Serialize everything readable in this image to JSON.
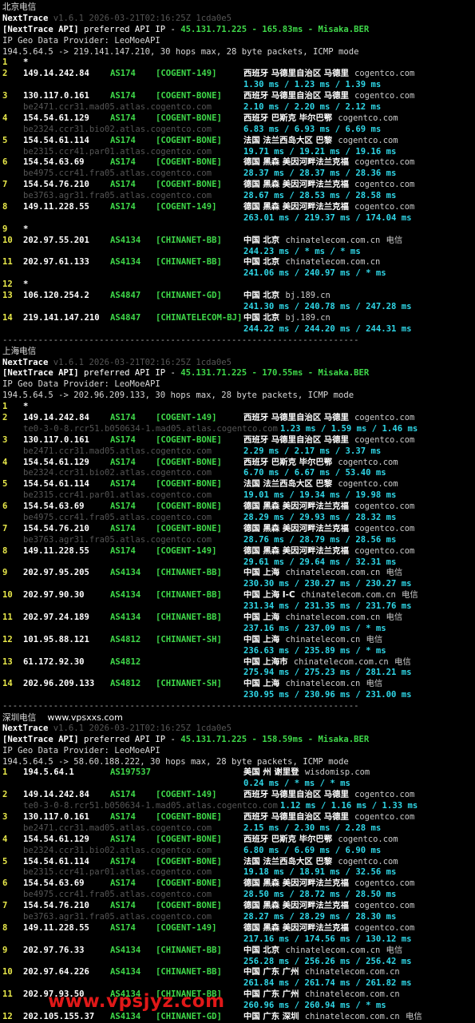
{
  "sections": [
    {
      "title": "北京电信",
      "watermark": "",
      "header": {
        "app": "NextTrace",
        "version_line": "v1.6.1 2026-03-21T02:16:25Z 1cda0e5",
        "api_prefix": "[NextTrace API]",
        "api_text": " preferred API IP - ",
        "api_ip": "45.131.71.225",
        "api_dash": " - ",
        "api_ms": "165.83ms",
        "api_node": "Misaka.BER",
        "geo_provider": "IP Geo Data Provider: LeoMoeAPI",
        "trace_cmd": "194.5.64.5 -> 219.141.147.210, 30 hops max, 28 byte packets, ICMP mode"
      },
      "hops": [
        {
          "n": "1",
          "ip": "*",
          "as": "",
          "tag": "",
          "geo": "",
          "host": "",
          "isp": "",
          "rdns": "",
          "rtt": ""
        },
        {
          "n": "2",
          "ip": "149.14.242.84",
          "as": "AS174",
          "tag": "[COGENT-149]",
          "geo": "西班牙 马德里自治区 马德里",
          "host": "cogentco.com",
          "isp": "",
          "rdns": "",
          "rtt": "1.30 ms / 1.23 ms / 1.39 ms"
        },
        {
          "n": "3",
          "ip": "130.117.0.161",
          "as": "AS174",
          "tag": "[COGENT-BONE]",
          "geo": "西班牙 马德里自治区 马德里",
          "host": "cogentco.com",
          "isp": "",
          "rdns": "be2471.ccr31.mad05.atlas.cogentco.com",
          "rtt": "2.10 ms / 2.20 ms / 2.12 ms"
        },
        {
          "n": "4",
          "ip": "154.54.61.129",
          "as": "AS174",
          "tag": "[COGENT-BONE]",
          "geo": "西班牙 巴斯克 毕尔巴鄂",
          "host": "cogentco.com",
          "isp": "",
          "rdns": "be2324.ccr31.bio02.atlas.cogentco.com",
          "rtt": "6.83 ms / 6.93 ms / 6.69 ms"
        },
        {
          "n": "5",
          "ip": "154.54.61.114",
          "as": "AS174",
          "tag": "[COGENT-BONE]",
          "geo": "法国 法兰西岛大区 巴黎",
          "host": "cogentco.com",
          "isp": "",
          "rdns": "be2315.ccr41.par01.atlas.cogentco.com",
          "rtt": "19.71 ms / 19.21 ms / 19.16 ms"
        },
        {
          "n": "6",
          "ip": "154.54.63.69",
          "as": "AS174",
          "tag": "[COGENT-BONE]",
          "geo": "德国 黑森 美因河畔法兰克福",
          "host": "cogentco.com",
          "isp": "",
          "rdns": "be4975.ccr41.fra05.atlas.cogentco.com",
          "rtt": "28.37 ms / 28.37 ms / 28.36 ms"
        },
        {
          "n": "7",
          "ip": "154.54.76.210",
          "as": "AS174",
          "tag": "[COGENT-BONE]",
          "geo": "德国 黑森 美因河畔法兰克福",
          "host": "cogentco.com",
          "isp": "",
          "rdns": "be3763.agr31.fra05.atlas.cogentco.com",
          "rtt": "28.67 ms / 28.53 ms / 28.58 ms"
        },
        {
          "n": "8",
          "ip": "149.11.228.55",
          "as": "AS174",
          "tag": "[COGENT-149]",
          "geo": "德国 黑森 美因河畔法兰克福",
          "host": "cogentco.com",
          "isp": "",
          "rdns": "",
          "rtt": "263.01 ms / 219.37 ms / 174.04 ms"
        },
        {
          "n": "9",
          "ip": "*",
          "as": "",
          "tag": "",
          "geo": "",
          "host": "",
          "isp": "",
          "rdns": "",
          "rtt": ""
        },
        {
          "n": "10",
          "ip": "202.97.55.201",
          "as": "AS4134",
          "tag": "[CHINANET-BB]",
          "geo": "中国 北京",
          "host": "chinatelecom.com.cn",
          "isp": "电信",
          "rdns": "",
          "rtt": "244.23 ms / * ms / * ms"
        },
        {
          "n": "11",
          "ip": "202.97.61.133",
          "as": "AS4134",
          "tag": "[CHINANET-BB]",
          "geo": "中国 北京",
          "host": "chinatelecom.com.cn",
          "isp": "",
          "rdns": "",
          "rtt": "241.06 ms / 240.97 ms / * ms"
        },
        {
          "n": "12",
          "ip": "*",
          "as": "",
          "tag": "",
          "geo": "",
          "host": "",
          "isp": "",
          "rdns": "",
          "rtt": ""
        },
        {
          "n": "13",
          "ip": "106.120.254.2",
          "as": "AS4847",
          "tag": "[CHINANET-GD]",
          "geo": "中国 北京",
          "host": "bj.189.cn",
          "isp": "",
          "rdns": "",
          "rtt": "241.30 ms / 240.78 ms / 247.28 ms"
        },
        {
          "n": "14",
          "ip": "219.141.147.210",
          "as": "AS4847",
          "tag": "[CHINATELECOM-BJ]",
          "geo": "中国 北京",
          "host": "bj.189.cn",
          "isp": "",
          "rdns": "",
          "rtt": "244.22 ms / 244.20 ms / 244.31 ms"
        }
      ],
      "separator": "----------------------------------------------------------------------"
    },
    {
      "title": "上海电信",
      "watermark": "",
      "header": {
        "app": "NextTrace",
        "version_line": "v1.6.1 2026-03-21T02:16:25Z 1cda0e5",
        "api_prefix": "[NextTrace API]",
        "api_text": " preferred API IP - ",
        "api_ip": "45.131.71.225",
        "api_dash": " - ",
        "api_ms": "170.55ms",
        "api_node": "Misaka.BER",
        "geo_provider": "IP Geo Data Provider: LeoMoeAPI",
        "trace_cmd": "194.5.64.5 -> 202.96.209.133, 30 hops max, 28 byte packets, ICMP mode"
      },
      "hops": [
        {
          "n": "1",
          "ip": "*",
          "as": "",
          "tag": "",
          "geo": "",
          "host": "",
          "isp": "",
          "rdns": "",
          "rtt": ""
        },
        {
          "n": "2",
          "ip": "149.14.242.84",
          "as": "AS174",
          "tag": "[COGENT-149]",
          "geo": "西班牙 马德里自治区 马德里",
          "host": "cogentco.com",
          "isp": "",
          "rdns": "te0-3-0-8.rcr51.b050634-1.mad05.atlas.cogentco.com",
          "rtt": "1.23 ms / 1.59 ms / 1.46 ms",
          "rtt_inline": true
        },
        {
          "n": "3",
          "ip": "130.117.0.161",
          "as": "AS174",
          "tag": "[COGENT-BONE]",
          "geo": "西班牙 马德里自治区 马德里",
          "host": "cogentco.com",
          "isp": "",
          "rdns": "be2471.ccr31.mad05.atlas.cogentco.com",
          "rtt": "2.29 ms / 2.17 ms / 3.37 ms"
        },
        {
          "n": "4",
          "ip": "154.54.61.129",
          "as": "AS174",
          "tag": "[COGENT-BONE]",
          "geo": "西班牙 巴斯克 毕尔巴鄂",
          "host": "cogentco.com",
          "isp": "",
          "rdns": "be2324.ccr31.bio02.atlas.cogentco.com",
          "rtt": "6.70 ms / 6.67 ms / 53.40 ms"
        },
        {
          "n": "5",
          "ip": "154.54.61.114",
          "as": "AS174",
          "tag": "[COGENT-BONE]",
          "geo": "法国 法兰西岛大区 巴黎",
          "host": "cogentco.com",
          "isp": "",
          "rdns": "be2315.ccr41.par01.atlas.cogentco.com",
          "rtt": "19.01 ms / 19.34 ms / 19.98 ms"
        },
        {
          "n": "6",
          "ip": "154.54.63.69",
          "as": "AS174",
          "tag": "[COGENT-BONE]",
          "geo": "德国 黑森 美因河畔法兰克福",
          "host": "cogentco.com",
          "isp": "",
          "rdns": "be4975.ccr41.fra05.atlas.cogentco.com",
          "rtt": "28.29 ms / 29.93 ms / 28.32 ms"
        },
        {
          "n": "7",
          "ip": "154.54.76.210",
          "as": "AS174",
          "tag": "[COGENT-BONE]",
          "geo": "德国 黑森 美因河畔法兰克福",
          "host": "cogentco.com",
          "isp": "",
          "rdns": "be3763.agr31.fra05.atlas.cogentco.com",
          "rtt": "28.76 ms / 28.79 ms / 28.56 ms"
        },
        {
          "n": "8",
          "ip": "149.11.228.55",
          "as": "AS174",
          "tag": "[COGENT-149]",
          "geo": "德国 黑森 美因河畔法兰克福",
          "host": "cogentco.com",
          "isp": "",
          "rdns": "",
          "rtt": "29.61 ms / 29.64 ms / 32.31 ms"
        },
        {
          "n": "9",
          "ip": "202.97.95.205",
          "as": "AS4134",
          "tag": "[CHINANET-BB]",
          "geo": "中国 上海",
          "host": "chinatelecom.com.cn",
          "isp": "电信",
          "rdns": "",
          "rtt": "230.30 ms / 230.27 ms / 230.27 ms"
        },
        {
          "n": "10",
          "ip": "202.97.90.30",
          "as": "AS4134",
          "tag": "[CHINANET-BB]",
          "geo": "中国 上海 I-C",
          "host": "chinatelecom.com.cn",
          "isp": "电信",
          "rdns": "",
          "rtt": "231.34 ms / 231.35 ms / 231.76 ms"
        },
        {
          "n": "11",
          "ip": "202.97.24.189",
          "as": "AS4134",
          "tag": "[CHINANET-BB]",
          "geo": "中国 上海",
          "host": "chinatelecom.com.cn",
          "isp": "电信",
          "rdns": "",
          "rtt": "237.16 ms / 237.09 ms / * ms"
        },
        {
          "n": "12",
          "ip": "101.95.88.121",
          "as": "AS4812",
          "tag": "[CHINANET-SH]",
          "geo": "中国 上海",
          "host": "chinatelecom.cn",
          "isp": "电信",
          "rdns": "",
          "rtt": "236.63 ms / 235.89 ms / * ms"
        },
        {
          "n": "13",
          "ip": "61.172.92.30",
          "as": "AS4812",
          "tag": "",
          "geo": "中国 上海市",
          "host": "chinatelecom.com.cn",
          "isp": "电信",
          "rdns": "",
          "rtt": "275.94 ms / 275.23 ms / 281.21 ms"
        },
        {
          "n": "14",
          "ip": "202.96.209.133",
          "as": "AS4812",
          "tag": "[CHINANET-SH]",
          "geo": "中国 上海",
          "host": "chinatelecom.cn",
          "isp": "电信",
          "rdns": "",
          "rtt": "230.95 ms / 230.96 ms / 231.00 ms"
        }
      ],
      "separator": "----------------------------------------------------------------------"
    },
    {
      "title": "深圳电信",
      "watermark": "www.vpsxxs.com",
      "header": {
        "app": "NextTrace",
        "version_line": "v1.6.1 2026-03-21T02:16:25Z 1cda0e5",
        "api_prefix": "[NextTrace API]",
        "api_text": " preferred API IP - ",
        "api_ip": "45.131.71.225",
        "api_dash": " - ",
        "api_ms": "158.59ms",
        "api_node": "Misaka.BER",
        "geo_provider": "IP Geo Data Provider: LeoMoeAPI",
        "trace_cmd": "194.5.64.5 -> 58.60.188.222, 30 hops max, 28 byte packets, ICMP mode"
      },
      "hops": [
        {
          "n": "1",
          "ip": "194.5.64.1",
          "as": "AS197537",
          "tag": "",
          "geo": "美国 州 谢里登",
          "host": "wisdomisp.com",
          "isp": "",
          "rdns": "",
          "rtt": "0.24 ms / * ms / * ms"
        },
        {
          "n": "2",
          "ip": "149.14.242.84",
          "as": "AS174",
          "tag": "[COGENT-149]",
          "geo": "西班牙 马德里自治区 马德里",
          "host": "cogentco.com",
          "isp": "",
          "rdns": "te0-3-0-8.rcr51.b050634-1.mad05.atlas.cogentco.com",
          "rtt": "1.12 ms / 1.16 ms / 1.33 ms",
          "rtt_inline": true
        },
        {
          "n": "3",
          "ip": "130.117.0.161",
          "as": "AS174",
          "tag": "[COGENT-BONE]",
          "geo": "西班牙 马德里自治区 马德里",
          "host": "cogentco.com",
          "isp": "",
          "rdns": "be2471.ccr31.mad05.atlas.cogentco.com",
          "rtt": "2.15 ms / 2.30 ms / 2.28 ms"
        },
        {
          "n": "4",
          "ip": "154.54.61.129",
          "as": "AS174",
          "tag": "[COGENT-BONE]",
          "geo": "西班牙 巴斯克 毕尔巴鄂",
          "host": "cogentco.com",
          "isp": "",
          "rdns": "be2324.ccr31.bio02.atlas.cogentco.com",
          "rtt": "6.80 ms / 6.69 ms / 6.90 ms"
        },
        {
          "n": "5",
          "ip": "154.54.61.114",
          "as": "AS174",
          "tag": "[COGENT-BONE]",
          "geo": "法国 法兰西岛大区 巴黎",
          "host": "cogentco.com",
          "isp": "",
          "rdns": "be2315.ccr41.par01.atlas.cogentco.com",
          "rtt": "19.18 ms / 18.91 ms / 32.56 ms"
        },
        {
          "n": "6",
          "ip": "154.54.63.69",
          "as": "AS174",
          "tag": "[COGENT-BONE]",
          "geo": "德国 黑森 美因河畔法兰克福",
          "host": "cogentco.com",
          "isp": "",
          "rdns": "be4975.ccr41.fra05.atlas.cogentco.com",
          "rtt": "28.50 ms / 28.72 ms / 28.50 ms"
        },
        {
          "n": "7",
          "ip": "154.54.76.210",
          "as": "AS174",
          "tag": "[COGENT-BONE]",
          "geo": "德国 黑森 美因河畔法兰克福",
          "host": "cogentco.com",
          "isp": "",
          "rdns": "be3763.agr31.fra05.atlas.cogentco.com",
          "rtt": "28.27 ms / 28.29 ms / 28.30 ms"
        },
        {
          "n": "8",
          "ip": "149.11.228.55",
          "as": "AS174",
          "tag": "[COGENT-149]",
          "geo": "德国 黑森 美因河畔法兰克福",
          "host": "cogentco.com",
          "isp": "",
          "rdns": "",
          "rtt": "217.16 ms / 174.56 ms / 130.12 ms"
        },
        {
          "n": "9",
          "ip": "202.97.76.33",
          "as": "AS4134",
          "tag": "[CHINANET-BB]",
          "geo": "中国 北京",
          "host": "chinatelecom.com.cn",
          "isp": "电信",
          "rdns": "",
          "rtt": "256.28 ms / 256.26 ms / 256.42 ms"
        },
        {
          "n": "10",
          "ip": "202.97.64.226",
          "as": "AS4134",
          "tag": "[CHINANET-BB]",
          "geo": "中国 广东 广州",
          "host": "chinatelecom.com.cn",
          "isp": "",
          "rdns": "",
          "rtt": "261.84 ms / 261.74 ms / 261.82 ms"
        },
        {
          "n": "11",
          "ip": "202.97.93.50",
          "as": "AS4134",
          "tag": "[CHINANET-BB]",
          "geo": "中国 广东 广州",
          "host": "chinatelecom.com.cn",
          "isp": "",
          "rdns": "",
          "rtt": "260.96 ms / 260.94 ms / * ms"
        },
        {
          "n": "12",
          "ip": "202.105.155.37",
          "as": "AS4134",
          "tag": "[CHINANET-GD]",
          "geo": "中国 广东 深圳",
          "host": "chinatelecom.com.cn",
          "isp": "电信",
          "rdns": "",
          "rtt": ""
        }
      ],
      "separator": ""
    }
  ],
  "footer_watermark": "www.vpsjyz.com",
  "colors": {
    "background": "#000000",
    "ip_text": "#ffffff",
    "asn_green": "#3fd94a",
    "rtt_cyan": "#2fd6e6",
    "hop_number_yellow": "#e8e84a",
    "rdns_dim": "#555555",
    "watermark_red": "#e01818"
  }
}
